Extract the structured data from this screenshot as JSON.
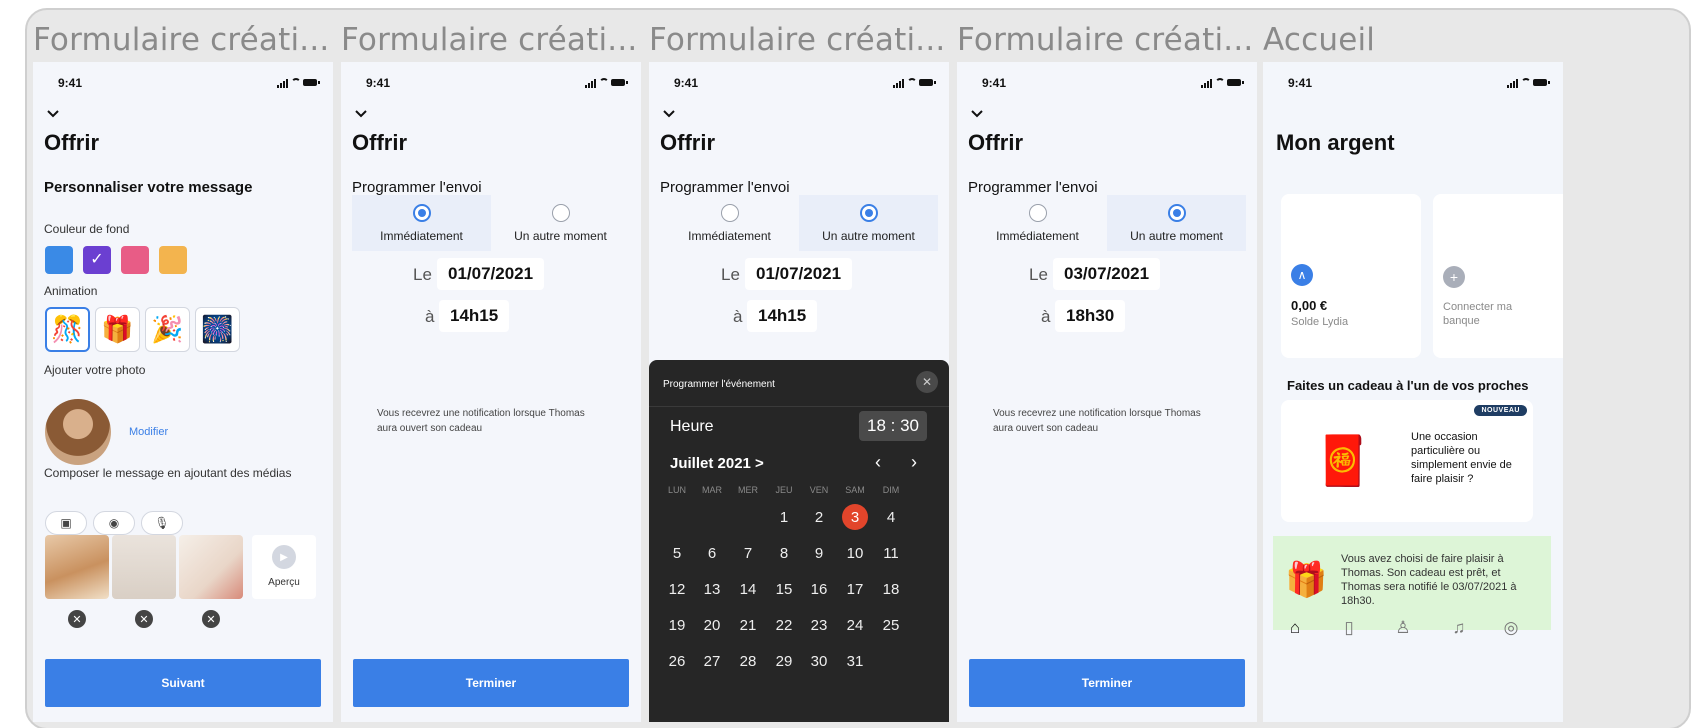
{
  "frames": [
    {
      "title": "Formulaire créati..."
    },
    {
      "title": "Formulaire créati..."
    },
    {
      "title": "Formulaire créati..."
    },
    {
      "title": "Formulaire créati..."
    },
    {
      "title": "Accueil"
    }
  ],
  "status_time": "9:41",
  "offrir": "Offrir",
  "screen1": {
    "subtitle": "Personnaliser votre message",
    "bg_color_label": "Couleur de fond",
    "colors": [
      "#3a8ae6",
      "#6b3fd1",
      "#e85c86",
      "#f3b44e"
    ],
    "animation_label": "Animation",
    "photo_label": "Ajouter votre photo",
    "modify_link": "Modifier",
    "compose_label": "Composer le message en ajoutant des médias",
    "preview_label": "Aperçu",
    "next_button": "Suivant"
  },
  "schedule": {
    "subtitle": "Programmer l'envoi",
    "option_now": "Immédiatement",
    "option_later": "Un autre moment",
    "le": "Le",
    "a": "à",
    "note": "Vous recevrez une notification lorsque Thomas aura ouvert son cadeau",
    "finish_button": "Terminer"
  },
  "screen2": {
    "date": "01/07/2021",
    "time": "14h15"
  },
  "screen3": {
    "date": "01/07/2021",
    "time": "14h15",
    "sheet_title": "Programmer l'événement",
    "hour_label": "Heure",
    "hour_value": "18 : 30",
    "month_label": "Juillet 2021 >",
    "weekdays": [
      "LUN",
      "MAR",
      "MER",
      "JEU",
      "VEN",
      "SAM",
      "DIM"
    ],
    "days": [
      "1",
      "2",
      "3",
      "4",
      "5",
      "6",
      "7",
      "8",
      "9",
      "10",
      "11",
      "12",
      "13",
      "14",
      "15",
      "16",
      "17",
      "18",
      "19",
      "20",
      "21",
      "22",
      "23",
      "24",
      "25",
      "26",
      "27",
      "28",
      "29",
      "30",
      "31"
    ],
    "selected_day": "3"
  },
  "screen4": {
    "date": "03/07/2021",
    "time": "18h30"
  },
  "home": {
    "title": "Mon argent",
    "balance_amount": "0,00 €",
    "balance_label": "Solde Lydia",
    "connect_bank": "Connecter ma banque",
    "gift_section": "Faites un cadeau à l'un de vos proches",
    "badge": "NOUVEAU",
    "gift_text": "Une occasion particulière ou simplement envie de faire plaisir ?",
    "toast": "Vous avez choisi de faire plaisir à Thomas. Son cadeau est prêt, et Thomas sera notifié le 03/07/2021 à 18h30."
  }
}
